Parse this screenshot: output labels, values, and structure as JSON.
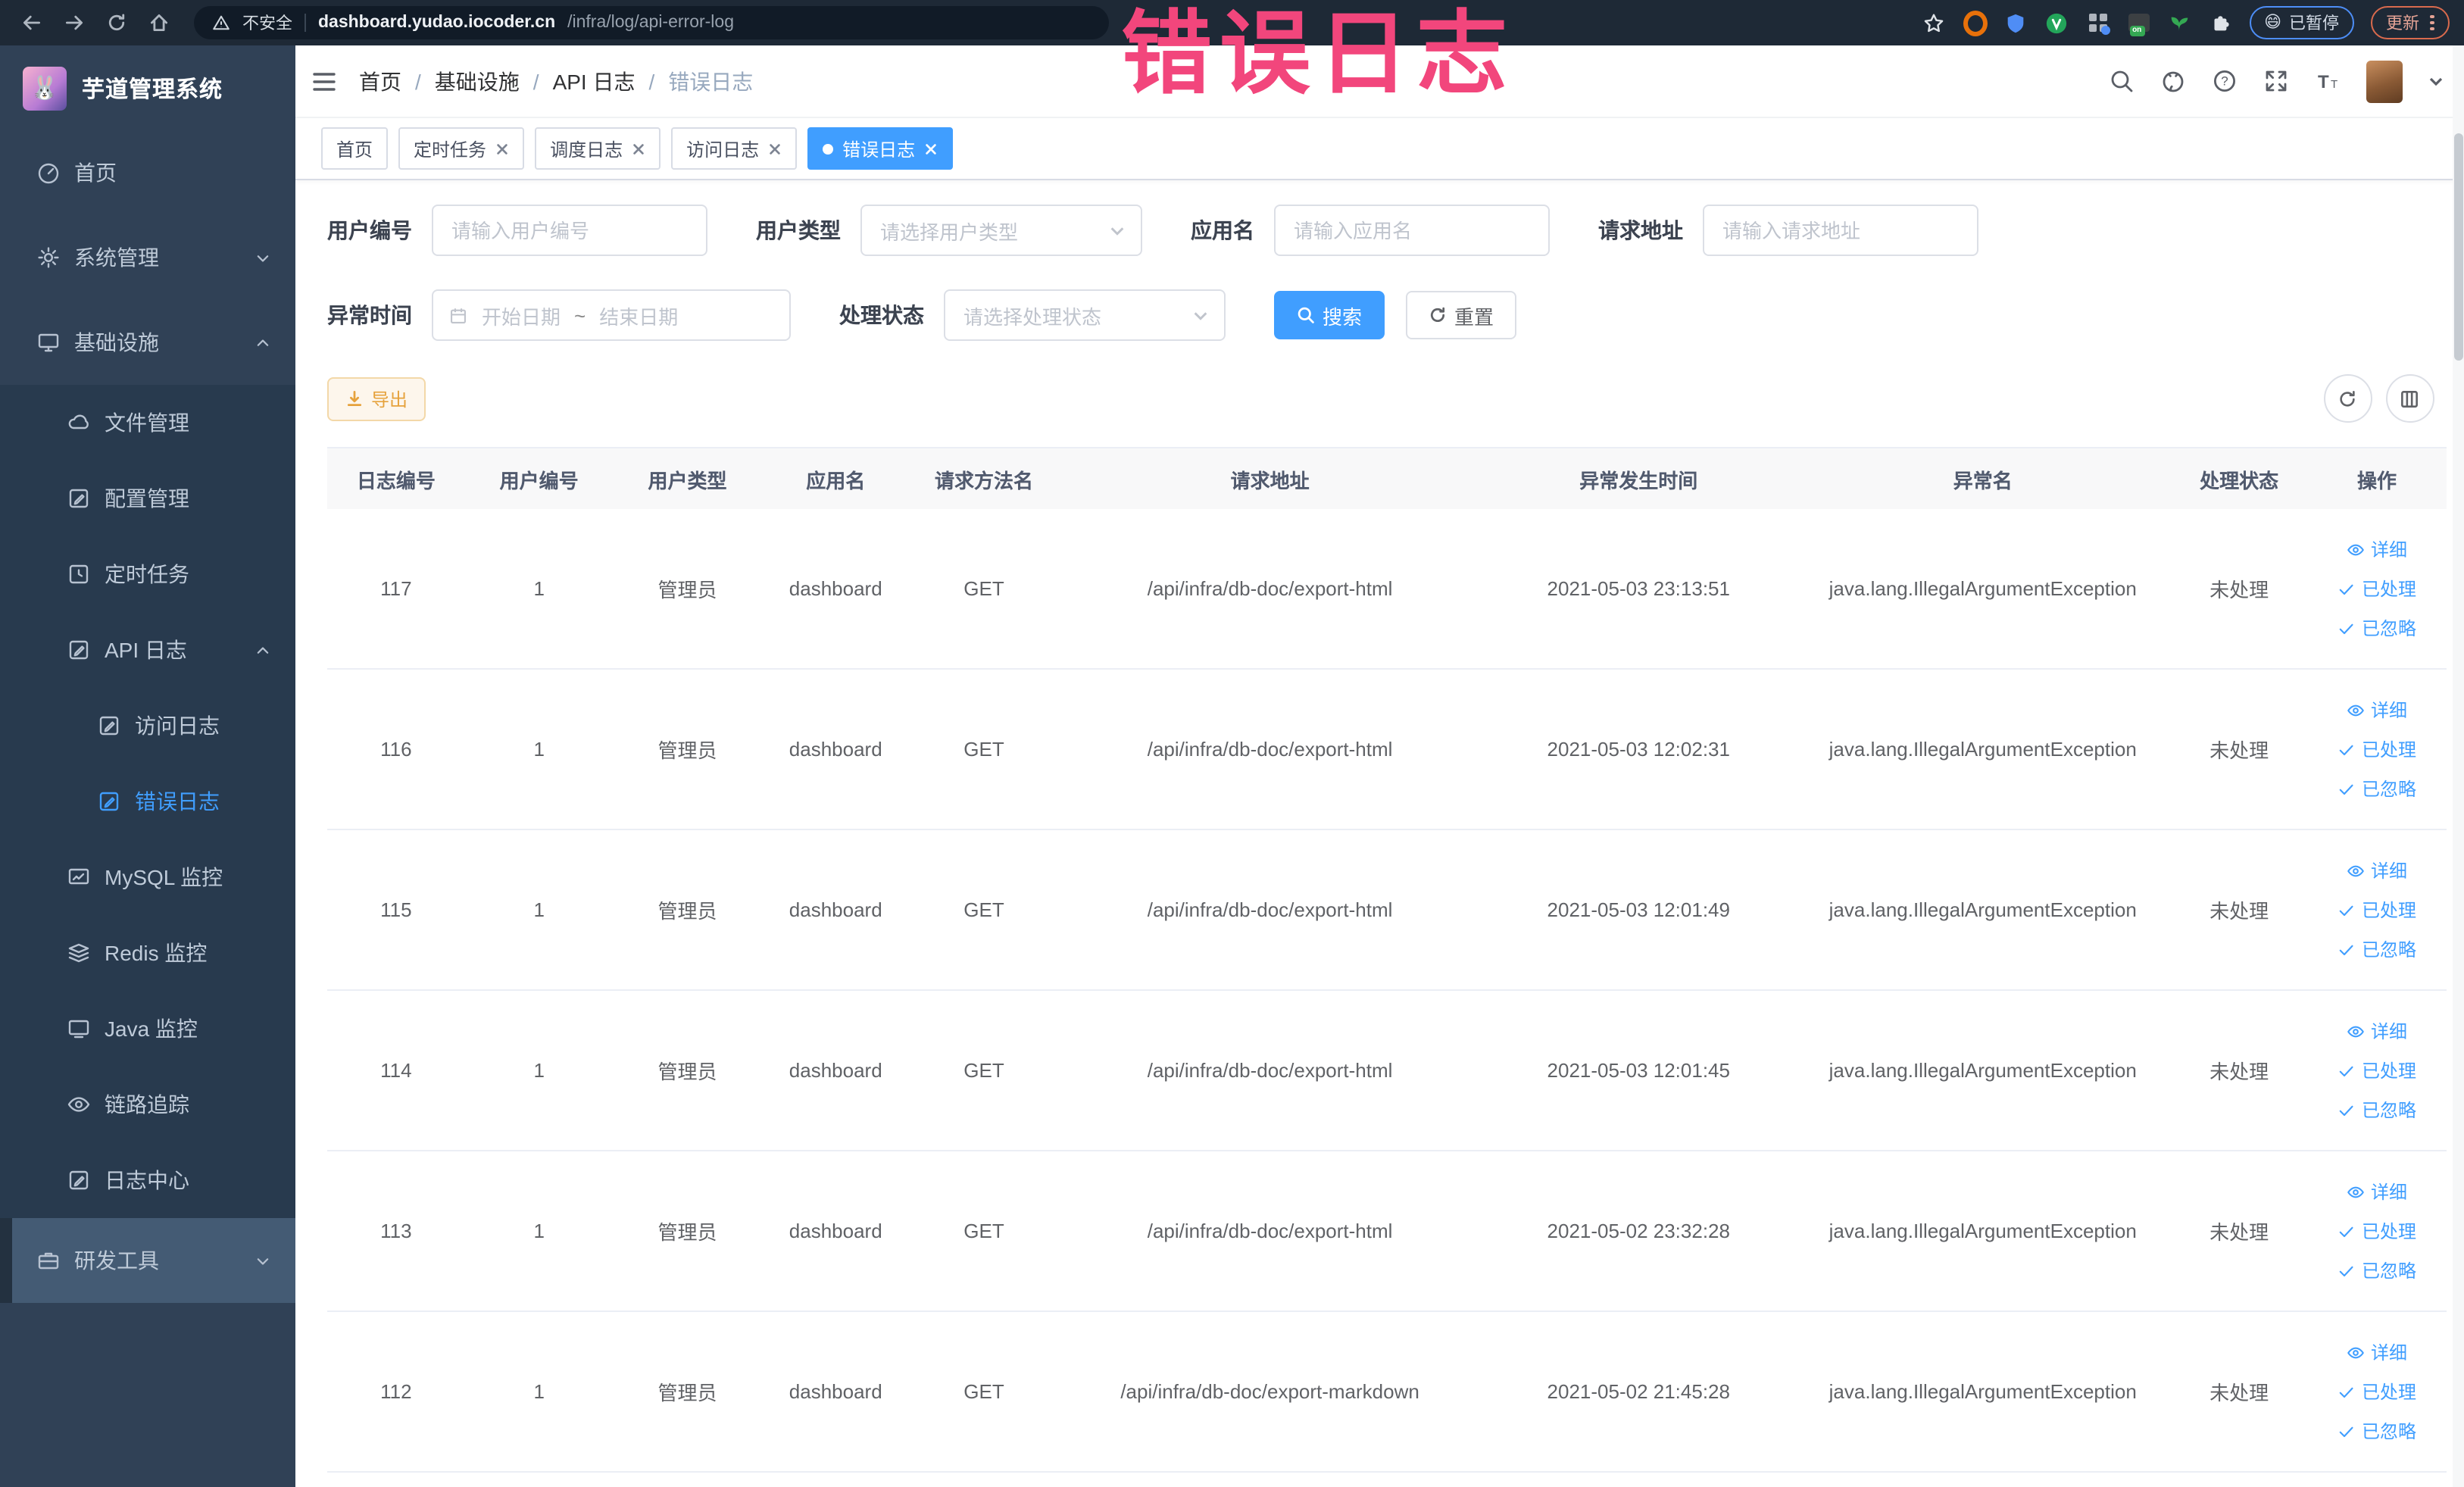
{
  "watermark": "错误日志",
  "browser": {
    "security": "不安全",
    "url_domain": "dashboard.yudao.iocoder.cn",
    "url_path": "/infra/log/api-error-log",
    "paused_emoji": "😄",
    "paused_label": "已暂停",
    "update_label": "更新"
  },
  "sidebar": {
    "title": "芋道管理系统",
    "items": {
      "home": "首页",
      "system": "系统管理",
      "infra": "基础设施",
      "file": "文件管理",
      "config": "配置管理",
      "job": "定时任务",
      "api_log": "API 日志",
      "access_log": "访问日志",
      "error_log": "错误日志",
      "mysql": "MySQL 监控",
      "redis": "Redis 监控",
      "java": "Java 监控",
      "trace": "链路追踪",
      "log_center": "日志中心",
      "dev_tools": "研发工具"
    }
  },
  "breadcrumb": [
    "首页",
    "基础设施",
    "API 日志",
    "错误日志"
  ],
  "tabs": [
    {
      "label": "首页"
    },
    {
      "label": "定时任务"
    },
    {
      "label": "调度日志"
    },
    {
      "label": "访问日志"
    },
    {
      "label": "错误日志"
    }
  ],
  "filters": {
    "user_id": {
      "label": "用户编号",
      "placeholder": "请输入用户编号"
    },
    "user_type": {
      "label": "用户类型",
      "placeholder": "请选择用户类型"
    },
    "app_name": {
      "label": "应用名",
      "placeholder": "请输入应用名"
    },
    "request_url": {
      "label": "请求地址",
      "placeholder": "请输入请求地址"
    },
    "exception_time": {
      "label": "异常时间",
      "start_placeholder": "开始日期",
      "separator": "~",
      "end_placeholder": "结束日期"
    },
    "process_status": {
      "label": "处理状态",
      "placeholder": "请选择处理状态"
    },
    "search_label": "搜索",
    "reset_label": "重置"
  },
  "toolbar": {
    "export_label": "导出"
  },
  "table": {
    "headers": [
      "日志编号",
      "用户编号",
      "用户类型",
      "应用名",
      "请求方法名",
      "请求地址",
      "异常发生时间",
      "异常名",
      "处理状态",
      "操作"
    ],
    "rows": [
      {
        "id": "117",
        "user_id": "1",
        "user_type": "管理员",
        "app_name": "dashboard",
        "method": "GET",
        "url": "/api/infra/db-doc/export-html",
        "time": "2021-05-03 23:13:51",
        "exception": "java.lang.IllegalArgumentException",
        "status": "未处理"
      },
      {
        "id": "116",
        "user_id": "1",
        "user_type": "管理员",
        "app_name": "dashboard",
        "method": "GET",
        "url": "/api/infra/db-doc/export-html",
        "time": "2021-05-03 12:02:31",
        "exception": "java.lang.IllegalArgumentException",
        "status": "未处理"
      },
      {
        "id": "115",
        "user_id": "1",
        "user_type": "管理员",
        "app_name": "dashboard",
        "method": "GET",
        "url": "/api/infra/db-doc/export-html",
        "time": "2021-05-03 12:01:49",
        "exception": "java.lang.IllegalArgumentException",
        "status": "未处理"
      },
      {
        "id": "114",
        "user_id": "1",
        "user_type": "管理员",
        "app_name": "dashboard",
        "method": "GET",
        "url": "/api/infra/db-doc/export-html",
        "time": "2021-05-03 12:01:45",
        "exception": "java.lang.IllegalArgumentException",
        "status": "未处理"
      },
      {
        "id": "113",
        "user_id": "1",
        "user_type": "管理员",
        "app_name": "dashboard",
        "method": "GET",
        "url": "/api/infra/db-doc/export-html",
        "time": "2021-05-02 23:32:28",
        "exception": "java.lang.IllegalArgumentException",
        "status": "未处理"
      },
      {
        "id": "112",
        "user_id": "1",
        "user_type": "管理员",
        "app_name": "dashboard",
        "method": "GET",
        "url": "/api/infra/db-doc/export-markdown",
        "time": "2021-05-02 21:45:28",
        "exception": "java.lang.IllegalArgumentException",
        "status": "未处理"
      }
    ]
  },
  "row_actions": {
    "detail": "详细",
    "processed": "已处理",
    "ignored": "已忽略"
  },
  "colors": {
    "accent": "#409eff",
    "watermark": "#f2467c",
    "warning": "#e6a23c",
    "sidebar_bg": "#304156"
  }
}
